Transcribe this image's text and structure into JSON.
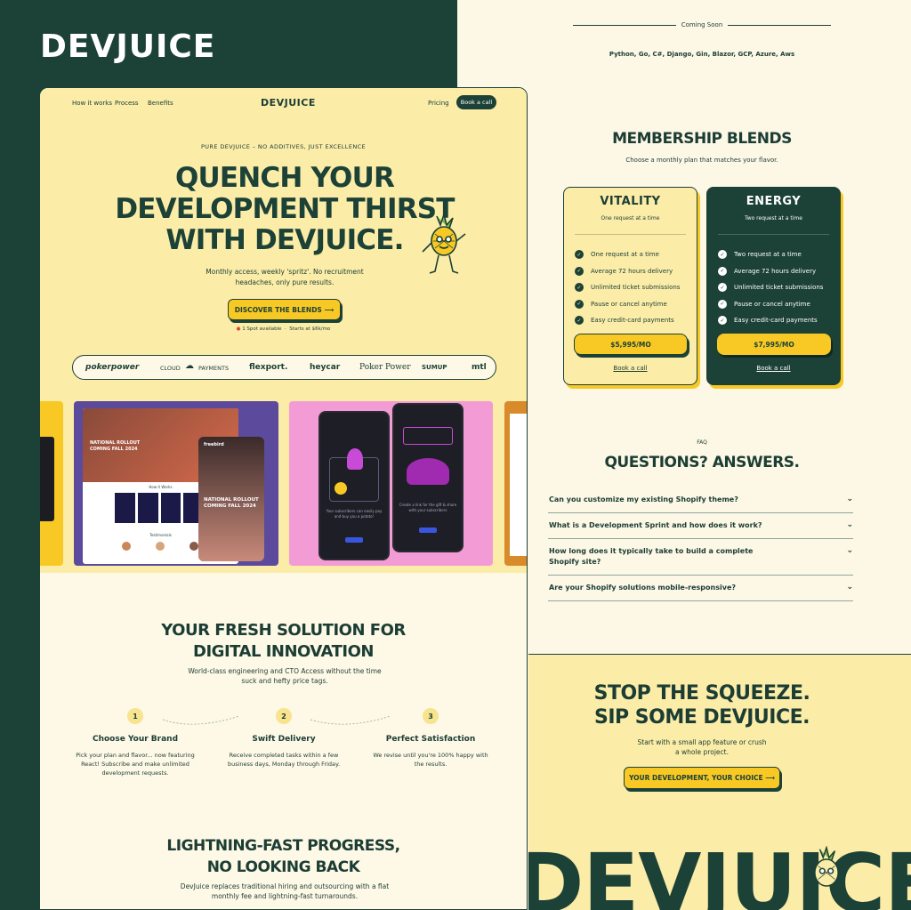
{
  "brand": "DEVJUICE",
  "nav": {
    "links": [
      "How it works",
      "Process",
      "Benefits"
    ],
    "logo": "DEVJUICE",
    "pricing": "Pricing",
    "book": "Book a call"
  },
  "hero": {
    "eyebrow": "PURE DEVJUICE – NO ADDITIVES, JUST EXCELLENCE",
    "title_1": "QUENCH YOUR",
    "title_2": "DEVELOPMENT THIRST",
    "title_3": "WITH DEVJUICE.",
    "subtitle": "Monthly access, weekly 'spritz'. No recruitment headaches, only pure results.",
    "cta": "DISCOVER THE BLENDS",
    "spot": "1 Spot available",
    "starts": "Starts at $6k/mo"
  },
  "logos": [
    "pokerpower",
    "CLOUD",
    "PAYMENTS",
    "flexport.",
    "heycar",
    "Poker Power",
    "SUMUP",
    "mtl"
  ],
  "showcase": {
    "card1_text_1": "NATIONAL ROLLOUT",
    "card1_text_2": "COMING FALL 2024",
    "card1_brand": "freebird",
    "card1_how": "How it Works",
    "card1_testimonials": "Testimonials",
    "card2_text_1": "Your subscribers can easily pay and buy you a potato!",
    "card2_text_2": "Create a link for the gift & share with your subscribers"
  },
  "fresh": {
    "title_1": "YOUR FRESH SOLUTION FOR",
    "title_2": "DIGITAL INNOVATION",
    "subtitle": "World-class engineering and CTO Access without the time suck and hefty price tags.",
    "steps": [
      {
        "num": "1",
        "title": "Choose Your Brand",
        "text": "Pick your plan and flavor... now featuring React! Subscribe and make unlimited development requests."
      },
      {
        "num": "2",
        "title": "Swift Delivery",
        "text": "Receive completed tasks within a few business days, Monday through Friday."
      },
      {
        "num": "3",
        "title": "Perfect Satisfaction",
        "text": "We revise until you're 100% happy with the results."
      }
    ]
  },
  "fast": {
    "title_1": "LIGHTNING-FAST PROGRESS,",
    "title_2": "NO LOOKING BACK",
    "subtitle": "DevJuice replaces traditional hiring and outsourcing with a flat monthly fee and lightning-fast turnarounds."
  },
  "coming": {
    "label": "Coming Soon",
    "techs": "Python, Go, C#, Django, Gin, Blazor, GCP, Azure, Aws"
  },
  "membership": {
    "title": "MEMBERSHIP BLENDS",
    "subtitle": "Choose a monthly plan that matches your flavor.",
    "plans": [
      {
        "name": "VITALITY",
        "tag": "One request at a time",
        "features": [
          "One request at a time",
          "Average 72 hours delivery",
          "Unlimited ticket submissions",
          "Pause or cancel anytime",
          "Easy credit-card payments"
        ],
        "price": "$5,995/MO",
        "book": "Book a call"
      },
      {
        "name": "ENERGY",
        "tag": "Two request at a time",
        "features": [
          "Two request at a time",
          "Average 72 hours delivery",
          "Unlimited ticket submissions",
          "Pause or cancel anytime",
          "Easy credit-card payments"
        ],
        "price": "$7,995/MO",
        "book": "Book a call"
      }
    ]
  },
  "faq": {
    "label": "FAQ",
    "title": "QUESTIONS? ANSWERS.",
    "items": [
      "Can you customize my existing Shopify theme?",
      "What is a Development Sprint and how does it work?",
      "How long does it typically take to build a complete Shopify site?",
      "Are your Shopify solutions mobile-responsive?"
    ]
  },
  "squeeze": {
    "title_1": "STOP THE SQUEEZE.",
    "title_2": "SIP SOME DEVJUICE.",
    "subtitle": "Start with a small app feature or crush a whole project.",
    "cta": "YOUR DEVELOPMENT, YOUR CHOICE",
    "big_word": "DEVJUICE"
  },
  "colors": {
    "primary": "#1c4136",
    "accent": "#f8c924",
    "cream": "#fdf7e6",
    "hero": "#fbeca8",
    "pink": "#f39bd5",
    "purple": "#5c4a9c"
  }
}
